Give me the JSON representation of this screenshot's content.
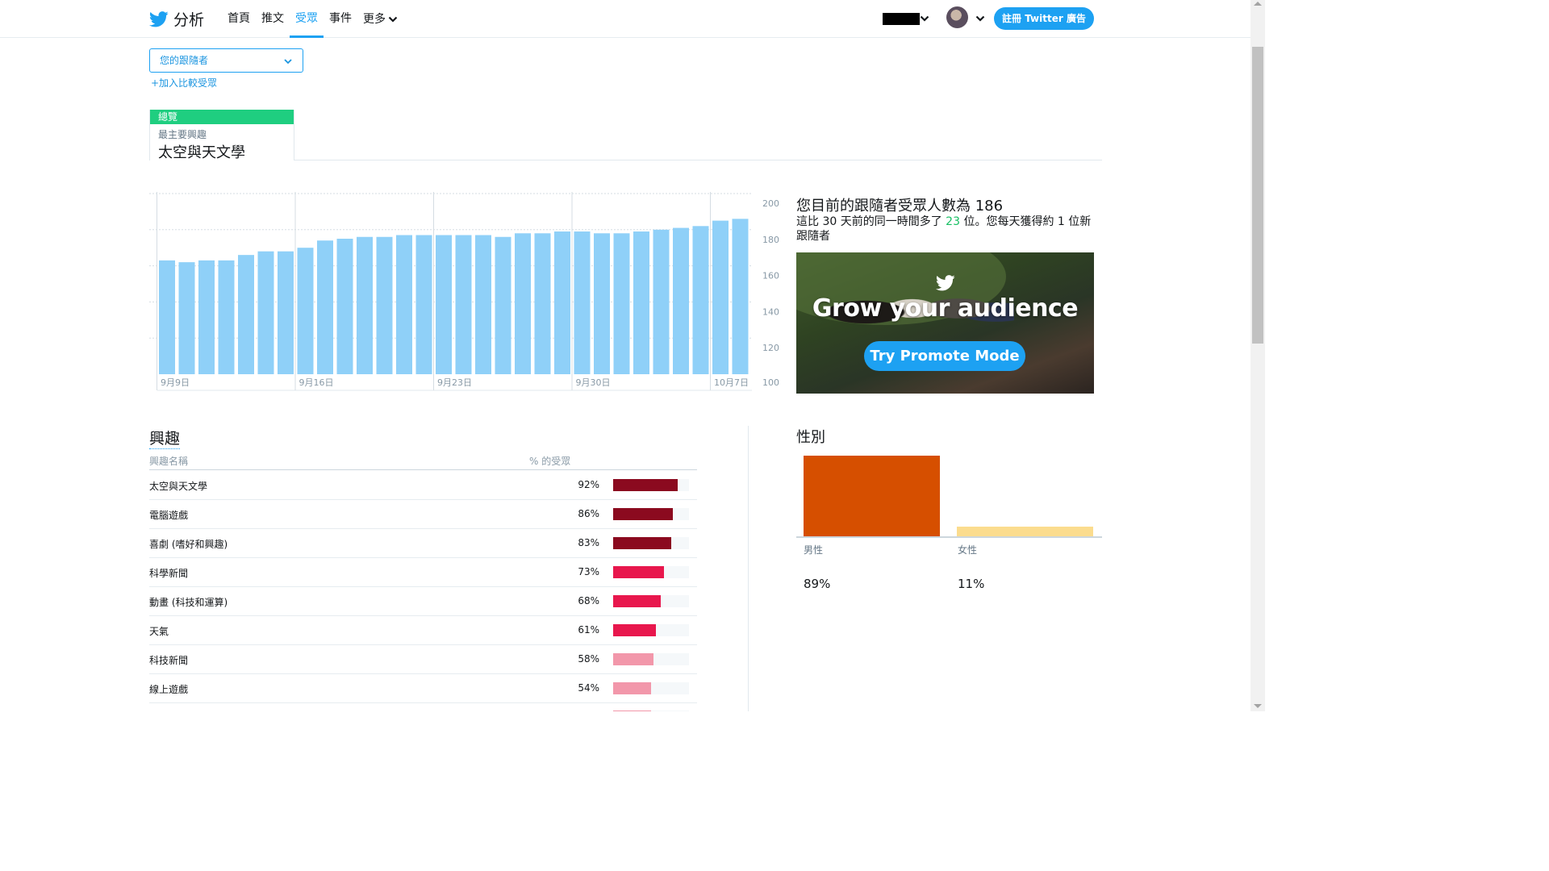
{
  "app": {
    "logo_text": "分析",
    "nav": [
      {
        "label": "首頁",
        "active": false
      },
      {
        "label": "推文",
        "active": false
      },
      {
        "label": "受眾",
        "active": true
      },
      {
        "label": "事件",
        "active": false
      },
      {
        "label": "更多",
        "active": false
      }
    ],
    "signup_label": "註冊 Twitter 廣告"
  },
  "audience_select": {
    "value": "您的跟隨者",
    "add_compare": "+加入比較受眾"
  },
  "overview": {
    "tab_label": "總覽",
    "sub_label": "最主要興趣",
    "value": "太空與天文學"
  },
  "followers": {
    "title": "您目前的跟隨者受眾人數為 186",
    "desc_before": "這比 30 天前的同一時間多了 ",
    "desc_gain": "23",
    "desc_after": " 位。您每天獲得約 1 位新跟隨者",
    "colors": {
      "bar": "#8fd0f8",
      "gain": "#17bf63"
    }
  },
  "chart_data": {
    "type": "bar",
    "categories": [
      "9月9日",
      "9月10日",
      "9月11日",
      "9月12日",
      "9月13日",
      "9月14日",
      "9月15日",
      "9月16日",
      "9月17日",
      "9月18日",
      "9月19日",
      "9月20日",
      "9月21日",
      "9月22日",
      "9月23日",
      "9月24日",
      "9月25日",
      "9月26日",
      "9月27日",
      "9月28日",
      "9月29日",
      "9月30日",
      "10月1日",
      "10月2日",
      "10月3日",
      "10月4日",
      "10月5日",
      "10月6日",
      "10月7日",
      "10月8日"
    ],
    "values": [
      163,
      162,
      163,
      163,
      166,
      168,
      168,
      170,
      174,
      175,
      176,
      176,
      177,
      177,
      177,
      177,
      177,
      176,
      178,
      178,
      179,
      179,
      178,
      178,
      179,
      180,
      181,
      182,
      185,
      186
    ],
    "x_tick_labels": [
      "9月9日",
      "9月16日",
      "9月23日",
      "9月30日",
      "10月7日"
    ],
    "y_tick_labels": [
      "200",
      "180",
      "160",
      "140",
      "120",
      "100"
    ],
    "ylim": [
      100,
      200
    ],
    "grid": true
  },
  "promo": {
    "headline": "Grow your audience",
    "button": "Try Promote Mode"
  },
  "interests": {
    "title": "興趣",
    "col_name": "興趣名稱",
    "col_pct": "% 的受眾",
    "rows": [
      {
        "name": "太空與天文學",
        "pct_label": "92%",
        "pct": 92,
        "color": "#8b0a1f"
      },
      {
        "name": "電腦遊戲",
        "pct_label": "86%",
        "pct": 86,
        "color": "#8b0a1f"
      },
      {
        "name": "喜劇 (嗜好和興趣)",
        "pct_label": "83%",
        "pct": 83,
        "color": "#8b0a1f"
      },
      {
        "name": "科學新聞",
        "pct_label": "73%",
        "pct": 73,
        "color": "#e8174d"
      },
      {
        "name": "動畫 (科技和運算)",
        "pct_label": "68%",
        "pct": 68,
        "color": "#e8174d"
      },
      {
        "name": "天氣",
        "pct_label": "61%",
        "pct": 61,
        "color": "#e8174d"
      },
      {
        "name": "科技新聞",
        "pct_label": "58%",
        "pct": 58,
        "color": "#f297aa"
      },
      {
        "name": "線上遊戲",
        "pct_label": "54%",
        "pct": 54,
        "color": "#f297aa"
      }
    ]
  },
  "gender": {
    "title": "性別",
    "items": [
      {
        "label": "男性",
        "pct_label": "89%",
        "pct": 89,
        "color": "#d64f00"
      },
      {
        "label": "女性",
        "pct_label": "11%",
        "pct": 11,
        "color": "#fbdc8e"
      }
    ]
  }
}
